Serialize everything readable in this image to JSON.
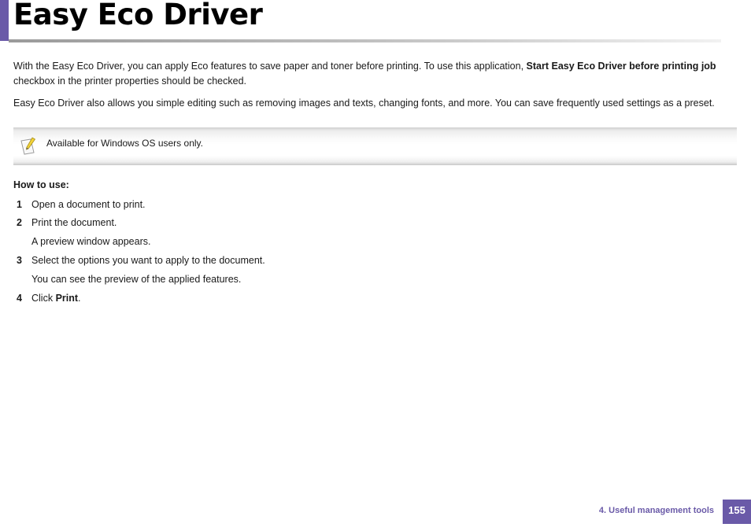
{
  "page": {
    "title": "Easy Eco Driver",
    "accent_color": "#6a5aa8"
  },
  "intro": {
    "p1_before": "With the Easy Eco Driver, you can apply Eco features to save paper and toner before printing. To use this application, ",
    "p1_bold": "Start Easy Eco Driver before printing job",
    "p1_after": " checkbox in the printer properties should be checked.",
    "p2": "Easy Eco Driver also allows you simple editing such as removing images and texts, changing fonts, and more. You can save frequently used settings as a preset."
  },
  "note": {
    "icon": "note-pencil-icon",
    "text": "Available for Windows OS users only."
  },
  "howto": {
    "heading": "How to use:",
    "steps": [
      {
        "num": "1",
        "text": "Open a document to print."
      },
      {
        "num": "2",
        "text": "Print the document."
      },
      {
        "num": "",
        "text": "A preview window appears."
      },
      {
        "num": "3",
        "text": "Select the options you want to apply to the document."
      },
      {
        "num": "",
        "text": "You can see the preview of the applied features."
      },
      {
        "num": "4",
        "text_before": "Click ",
        "text_bold": "Print",
        "text_after": "."
      }
    ]
  },
  "footer": {
    "chapter": "4.  Useful management tools",
    "page_number": "155"
  }
}
